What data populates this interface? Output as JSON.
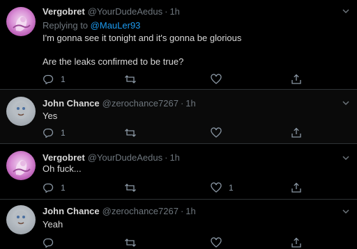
{
  "tweets": [
    {
      "name": "Vergobret",
      "handle": "@YourDudeAedus",
      "time": "1h",
      "replying_prefix": "Replying to",
      "replying_mention": "@MauLer93",
      "line1": "I'm gonna see it tonight and it's gonna be glorious",
      "line2": "Are the leaks confirmed to be true?",
      "reply_count": "1",
      "like_count": "",
      "avatar_icon": "pink-statue-avatar"
    },
    {
      "name": "John Chance",
      "handle": "@zerochance7267",
      "time": "1h",
      "line1": "Yes",
      "reply_count": "1",
      "like_count": "",
      "avatar_icon": "gray-face-avatar"
    },
    {
      "name": "Vergobret",
      "handle": "@YourDudeAedus",
      "time": "1h",
      "line1": "Oh fuck...",
      "reply_count": "1",
      "like_count": "1",
      "avatar_icon": "pink-statue-avatar"
    },
    {
      "name": "John Chance",
      "handle": "@zerochance7267",
      "time": "1h",
      "line1": "Yeah",
      "reply_count": "",
      "like_count": "",
      "avatar_icon": "gray-face-avatar"
    }
  ],
  "icons": {
    "reply": "reply-icon",
    "retweet": "retweet-icon",
    "like": "heart-icon",
    "share": "share-icon",
    "more": "chevron-down-icon"
  },
  "colors": {
    "background": "#000000",
    "text": "#d9d9d9",
    "muted": "#6e767d",
    "link": "#1d9bf0",
    "divider": "#2f3336"
  }
}
